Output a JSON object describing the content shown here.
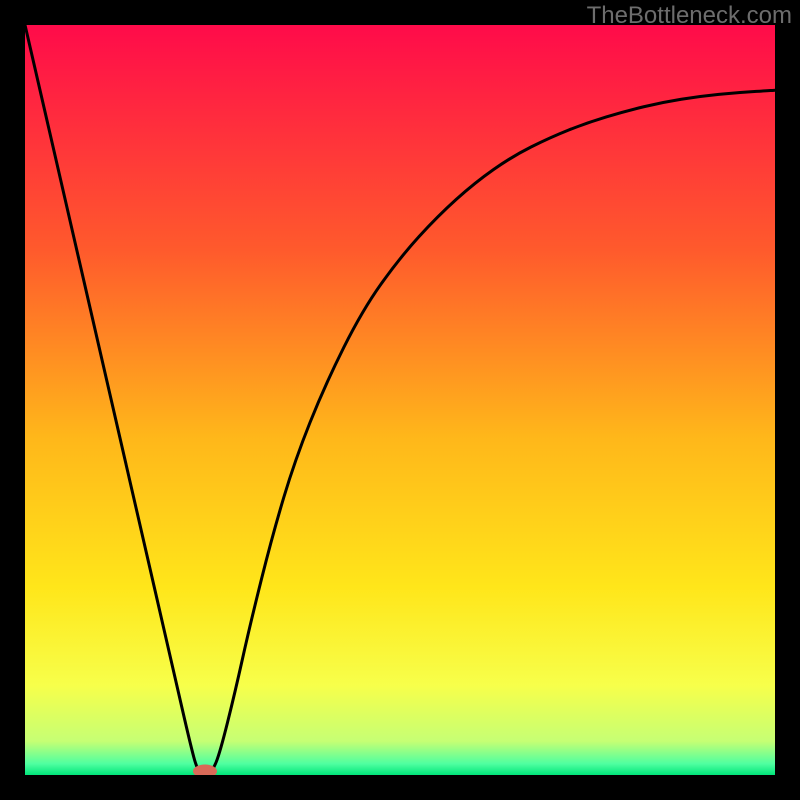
{
  "branding": {
    "text": "TheBottleneck.com"
  },
  "chart_data": {
    "type": "line",
    "title": "",
    "xlabel": "",
    "ylabel": "",
    "xlim": [
      0,
      100
    ],
    "ylim": [
      0,
      100
    ],
    "grid": false,
    "background_gradient": [
      {
        "offset": 0.0,
        "color": "#ff0b4a"
      },
      {
        "offset": 0.3,
        "color": "#ff5a2c"
      },
      {
        "offset": 0.55,
        "color": "#ffb71a"
      },
      {
        "offset": 0.75,
        "color": "#ffe61a"
      },
      {
        "offset": 0.88,
        "color": "#f7ff4a"
      },
      {
        "offset": 0.955,
        "color": "#c6ff74"
      },
      {
        "offset": 0.985,
        "color": "#4fffa0"
      },
      {
        "offset": 1.0,
        "color": "#00e57a"
      }
    ],
    "series": [
      {
        "name": "bottleneck-curve",
        "color": "#000000",
        "x": [
          0.0,
          5.0,
          10.0,
          15.0,
          20.0,
          22.0,
          23.0,
          24.0,
          25.0,
          26.0,
          28.0,
          30.0,
          33.0,
          36.0,
          40.0,
          45.0,
          50.0,
          55.0,
          60.0,
          65.0,
          70.0,
          75.0,
          80.0,
          85.0,
          90.0,
          95.0,
          100.0
        ],
        "y": [
          100.0,
          78.3,
          56.5,
          34.8,
          13.0,
          4.3,
          0.5,
          0.0,
          0.5,
          3.0,
          11.0,
          20.0,
          32.0,
          42.0,
          52.0,
          62.0,
          69.0,
          74.5,
          79.0,
          82.5,
          85.0,
          87.0,
          88.5,
          89.7,
          90.5,
          91.0,
          91.3
        ]
      }
    ],
    "marker": {
      "name": "minimum-marker",
      "x": 24.0,
      "y": 0.5,
      "color": "#d86a58",
      "rx": 1.6,
      "ry": 0.9
    }
  }
}
